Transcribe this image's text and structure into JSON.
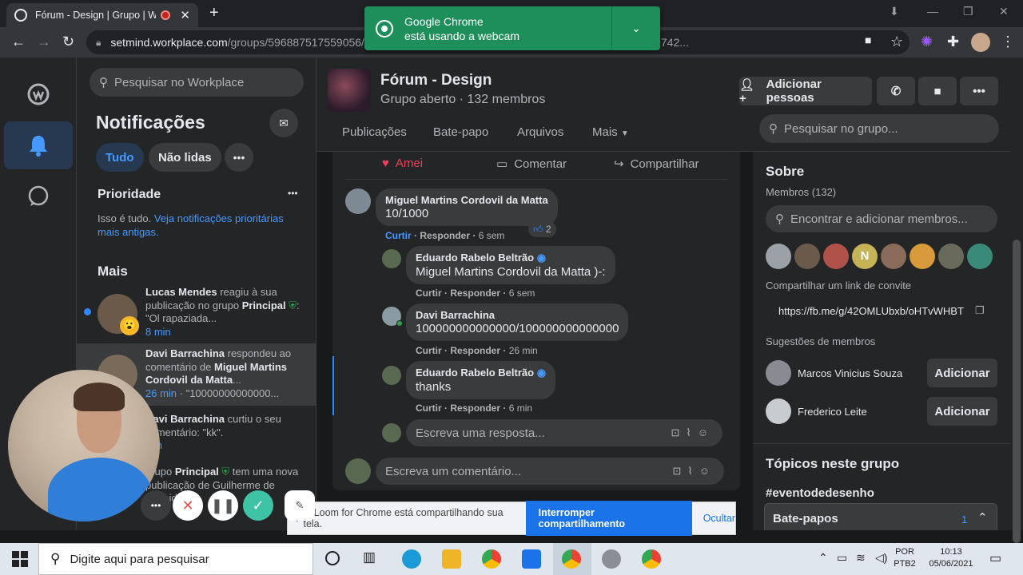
{
  "browser": {
    "tab_title": "Fórum - Design | Grupo | Wo",
    "tab_close": "✕",
    "new_tab": "+",
    "url_host": "setmind.workplace.com",
    "url_rest": "/groups/596887517559056/...comment_id=886...68097108&reply_comment_id=912119742...",
    "win_min": "—",
    "win_max": "❐",
    "win_close": "✕"
  },
  "chrome_popup": {
    "line1": "Google Chrome",
    "line2": "está usando a webcam"
  },
  "notifications": {
    "search_placeholder": "Pesquisar no Workplace",
    "title": "Notificações",
    "filter_all": "Tudo",
    "filter_unread": "Não lidas",
    "more": "•••",
    "priority_title": "Prioridade",
    "priority_more": "•••",
    "priority_text": "Isso é tudo.",
    "priority_link": "Veja notificações prioritárias mais antigas.",
    "more_title": "Mais",
    "items": [
      {
        "name": "Lucas Mendes",
        "text": " reagiu à sua publicação no grupo ",
        "group": "Principal",
        "snippet": ": \"Ol rapaziada...",
        "time": "8 min"
      },
      {
        "name": "Davi Barrachina",
        "text": " respondeu ao comentário de ",
        "group": "Miguel Martins Cordovil da Matta",
        "snippet": "...",
        "time": "26 min",
        "time_tail": " · \"10000000000000..."
      },
      {
        "name": "Davi Barrachina",
        "text": " curtiu o seu comentário: \"kk\".",
        "group": "",
        "snippet": "",
        "time": "min"
      },
      {
        "name": "",
        "text": "grupo ",
        "group": "Principal",
        "snippet": " tem uma nova publicação de Guilherme de Almeida",
        "time": ""
      }
    ]
  },
  "group": {
    "name": "Fórum - Design",
    "subtitle": "Grupo aberto · 132 membros",
    "add_people": "Adicionar pessoas",
    "tabs": [
      "Publicações",
      "Bate-papo",
      "Arquivos",
      "Mais"
    ],
    "search_placeholder": "Pesquisar no grupo..."
  },
  "post": {
    "actions": [
      "Amei",
      "Comentar",
      "Compartilhar"
    ],
    "comments": [
      {
        "name": "Miguel Martins Cordovil da Matta",
        "text": "10/1000",
        "like": "Curtir",
        "reply": "Responder",
        "time": "6 sem",
        "reactions": "2"
      },
      {
        "name": "Eduardo Rabelo Beltrão",
        "text": "Miguel Martins Cordovil da Matta )-:",
        "like": "Curtir",
        "reply": "Responder",
        "time": "6 sem"
      },
      {
        "name": "Davi Barrachina",
        "text": "100000000000000/100000000000000",
        "like": "Curtir",
        "reply": "Responder",
        "time": "26 min"
      },
      {
        "name": "Eduardo Rabelo Beltrão",
        "text": "thanks",
        "like": "Curtir",
        "reply": "Responder",
        "time": "6 min"
      }
    ],
    "reply_placeholder": "Escreva uma resposta...",
    "comment_placeholder": "Escreva um comentário..."
  },
  "about": {
    "title": "Sobre",
    "members": "Membros (132)",
    "find_placeholder": "Encontrar e adicionar membros...",
    "avatar_letter": "N",
    "invite_label": "Compartilhar um link de convite",
    "invite_link": "https://fb.me/g/42OMLUbxb/oHTvWHBT",
    "suggestions_label": "Sugestões de membros",
    "suggestions": [
      {
        "name": "Marcos Vinicius Souza",
        "button": "Adicionar"
      },
      {
        "name": "Frederico Leite",
        "button": "Adicionar"
      }
    ],
    "topics_title": "Tópicos neste grupo",
    "topic": "#eventodedesenho",
    "chats": "Bate-papos",
    "chats_count": "1"
  },
  "loom": {
    "message": "O Loom for Chrome está compartilhando sua tela.",
    "stop": "Interromper compartilhamento",
    "hide": "Ocultar"
  },
  "taskbar": {
    "search": "Digite aqui para pesquisar",
    "lang1": "POR",
    "lang2": "PTB2",
    "time": "10:13",
    "date": "05/06/2021"
  }
}
